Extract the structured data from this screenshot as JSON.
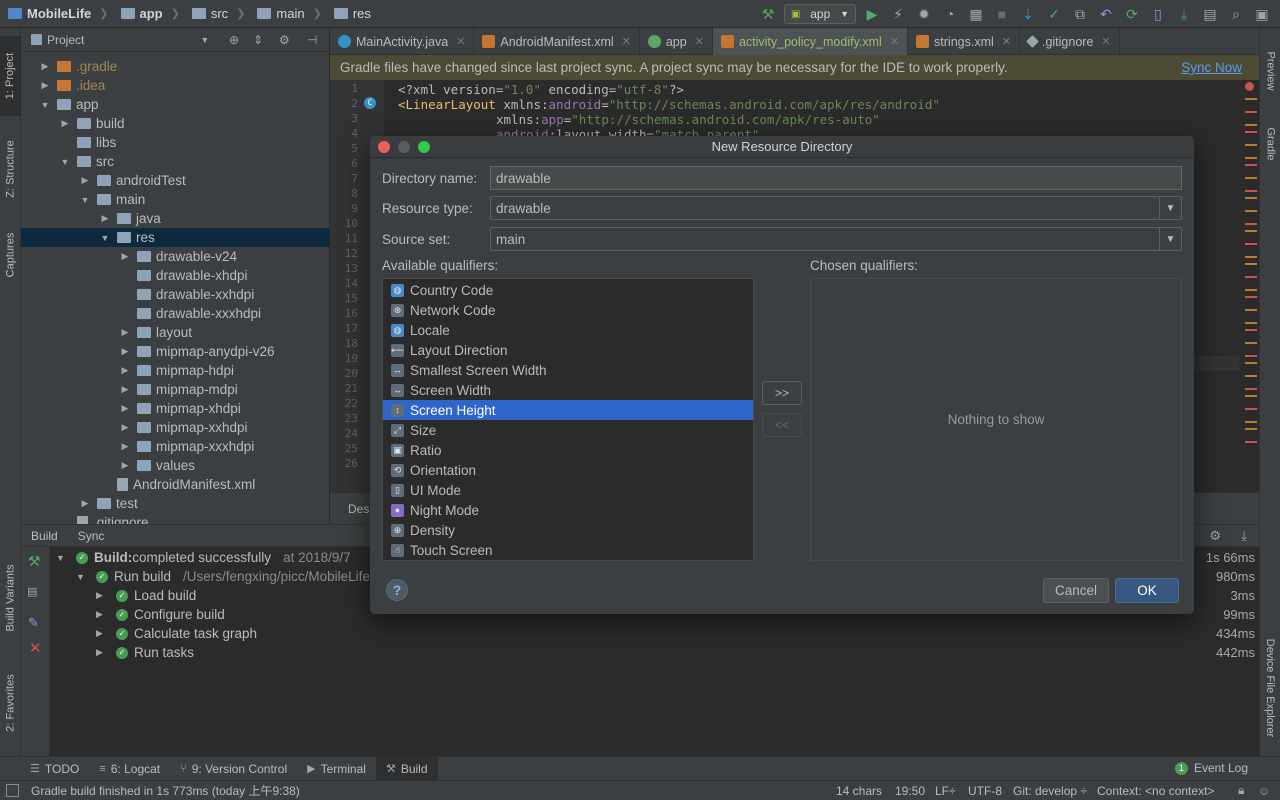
{
  "navbar": {
    "crumbs": [
      "MobileLife",
      "app",
      "src",
      "main",
      "res"
    ],
    "run_config": "app"
  },
  "left_strip": {
    "project": "1: Project",
    "structure": "Z: Structure",
    "captures": "Captures",
    "build_variants": "Build Variants",
    "favorites": "2: Favorites"
  },
  "right_strip": {
    "preview": "Preview",
    "gradle": "Gradle",
    "device_file_explorer": "Device File Explorer"
  },
  "project_panel": {
    "title": "Project",
    "tree": [
      {
        "label": ".gradle",
        "depth": 1,
        "arrow": "▶",
        "muted": true
      },
      {
        "label": ".idea",
        "depth": 1,
        "arrow": "▶",
        "muted": true
      },
      {
        "label": "app",
        "depth": 1,
        "arrow": "▼"
      },
      {
        "label": "build",
        "depth": 2,
        "arrow": "▶"
      },
      {
        "label": "libs",
        "depth": 2,
        "arrow": ""
      },
      {
        "label": "src",
        "depth": 2,
        "arrow": "▼"
      },
      {
        "label": "androidTest",
        "depth": 3,
        "arrow": "▶"
      },
      {
        "label": "main",
        "depth": 3,
        "arrow": "▼"
      },
      {
        "label": "java",
        "depth": 4,
        "arrow": "▶"
      },
      {
        "label": "res",
        "depth": 4,
        "arrow": "▼",
        "selected": true
      },
      {
        "label": "drawable-v24",
        "depth": 5,
        "arrow": "▶"
      },
      {
        "label": "drawable-xhdpi",
        "depth": 5,
        "arrow": ""
      },
      {
        "label": "drawable-xxhdpi",
        "depth": 5,
        "arrow": ""
      },
      {
        "label": "drawable-xxxhdpi",
        "depth": 5,
        "arrow": ""
      },
      {
        "label": "layout",
        "depth": 5,
        "arrow": "▶"
      },
      {
        "label": "mipmap-anydpi-v26",
        "depth": 5,
        "arrow": "▶"
      },
      {
        "label": "mipmap-hdpi",
        "depth": 5,
        "arrow": "▶"
      },
      {
        "label": "mipmap-mdpi",
        "depth": 5,
        "arrow": "▶"
      },
      {
        "label": "mipmap-xhdpi",
        "depth": 5,
        "arrow": "▶"
      },
      {
        "label": "mipmap-xxhdpi",
        "depth": 5,
        "arrow": "▶"
      },
      {
        "label": "mipmap-xxxhdpi",
        "depth": 5,
        "arrow": "▶"
      },
      {
        "label": "values",
        "depth": 5,
        "arrow": "▶"
      },
      {
        "label": "AndroidManifest.xml",
        "depth": 4,
        "arrow": "",
        "file": true
      },
      {
        "label": "test",
        "depth": 3,
        "arrow": "▶"
      },
      {
        "label": ".gitignore",
        "depth": 2,
        "arrow": "",
        "file": true
      }
    ]
  },
  "editor_tabs": [
    {
      "label": "MainActivity.java",
      "type": "java"
    },
    {
      "label": "AndroidManifest.xml",
      "type": "xml"
    },
    {
      "label": "app",
      "type": "gradle"
    },
    {
      "label": "activity_policy_modify.xml",
      "type": "xml",
      "active": true
    },
    {
      "label": "strings.xml",
      "type": "xml"
    },
    {
      "label": ".gitignore",
      "type": "git"
    }
  ],
  "banner": {
    "message": "Gradle files have changed since last project sync. A project sync may be necessary for the IDE to work properly.",
    "action": "Sync Now"
  },
  "editor": {
    "line_numbers": [
      "1",
      "2",
      "3",
      "4",
      "5",
      "6",
      "7",
      "8",
      "9",
      "10",
      "11",
      "12",
      "13",
      "14",
      "15",
      "16",
      "17",
      "18",
      "19",
      "20",
      "21",
      "22",
      "23",
      "24",
      "25",
      "26"
    ],
    "line1": {
      "a": "<?xml version=",
      "b": "\"1.0\"",
      "c": " encoding=",
      "d": "\"utf-8\"",
      "e": "?>"
    },
    "line2": {
      "tag": "<LinearLayout",
      "ns": " xmlns:",
      "nsname": "android",
      "eq": "=",
      "val": "\"http://schemas.android.com/apk/res/android\""
    },
    "line3": {
      "ns": "xmlns:",
      "nsname": "app",
      "eq": "=",
      "val": "\"http://schemas.android.com/apk/res-auto\""
    },
    "line4": {
      "ns": "android",
      "attr": ":layout_width=",
      "val": "\"match_parent\""
    },
    "bottom_tab": "Des"
  },
  "build_panel": {
    "tabs": [
      "Build",
      "Sync"
    ],
    "rows": [
      {
        "text": "Build:",
        "rest": " completed successfully",
        "extra": "at 2018/9/7",
        "time": "1s 66ms",
        "depth": 0,
        "arrow": "▼",
        "bold": true
      },
      {
        "text": "Run build",
        "extra": "/Users/fengxing/picc/MobileLife",
        "time": "980ms",
        "depth": 1,
        "arrow": "▼"
      },
      {
        "text": "Load build",
        "time": "3ms",
        "depth": 2,
        "arrow": "▶"
      },
      {
        "text": "Configure build",
        "time": "99ms",
        "depth": 2,
        "arrow": "▶"
      },
      {
        "text": "Calculate task graph",
        "time": "434ms",
        "depth": 2,
        "arrow": "▶"
      },
      {
        "text": "Run tasks",
        "time": "442ms",
        "depth": 2,
        "arrow": "▶"
      }
    ]
  },
  "tool_tabs": [
    {
      "label": "TODO"
    },
    {
      "label": "6: Logcat"
    },
    {
      "label": "9: Version Control"
    },
    {
      "label": "Terminal"
    },
    {
      "label": "Build",
      "active": true
    }
  ],
  "event_log": {
    "count": "1",
    "label": "Event Log"
  },
  "status_bar": {
    "message": "Gradle build finished in 1s 773ms (today 上午9:38)",
    "chars": "14 chars",
    "position": "19:50",
    "line_sep": "LF÷",
    "encoding": "UTF-8",
    "git": "Git: develop ÷",
    "context": "Context: <no context>"
  },
  "dialog": {
    "title": "New Resource Directory",
    "directory_name_label": "Directory name:",
    "directory_name_value": "drawable",
    "resource_type_label": "Resource type:",
    "resource_type_value": "drawable",
    "source_set_label": "Source set:",
    "source_set_value": "main",
    "available_label": "Available qualifiers:",
    "chosen_label": "Chosen qualifiers:",
    "qualifiers": [
      {
        "label": "Country Code",
        "icon": "globe"
      },
      {
        "label": "Network Code",
        "icon": "network"
      },
      {
        "label": "Locale",
        "icon": "globe"
      },
      {
        "label": "Layout Direction",
        "icon": "arrow-left"
      },
      {
        "label": "Smallest Screen Width",
        "icon": "width"
      },
      {
        "label": "Screen Width",
        "icon": "width"
      },
      {
        "label": "Screen Height",
        "icon": "height",
        "selected": true
      },
      {
        "label": "Size",
        "icon": "resize"
      },
      {
        "label": "Ratio",
        "icon": "ratio"
      },
      {
        "label": "Orientation",
        "icon": "orientation"
      },
      {
        "label": "UI Mode",
        "icon": "phone"
      },
      {
        "label": "Night Mode",
        "icon": "moon"
      },
      {
        "label": "Density",
        "icon": "density"
      },
      {
        "label": "Touch Screen",
        "icon": "hand"
      }
    ],
    "nothing_to_show": "Nothing to show",
    "add_button": ">>",
    "remove_button": "<<",
    "help": "?",
    "cancel": "Cancel",
    "ok": "OK"
  },
  "colors": {
    "selection": "#2f65ca",
    "ok_button": "#365880",
    "success": "#499c54",
    "link": "#589df6"
  }
}
